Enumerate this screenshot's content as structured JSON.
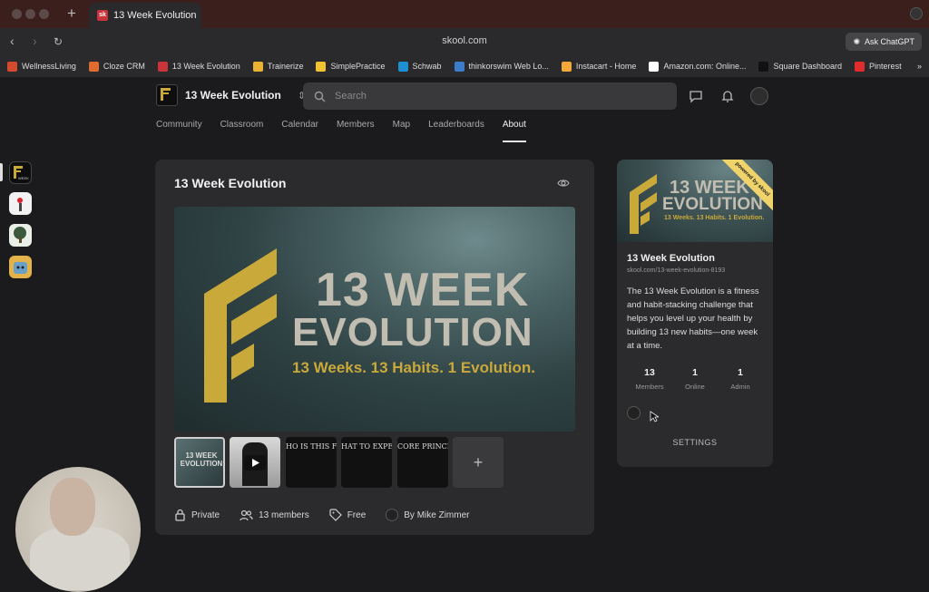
{
  "browser": {
    "tab_title": "13 Week Evolution",
    "url": "skool.com",
    "ask_chatgpt": "Ask ChatGPT",
    "bookmarks": [
      {
        "label": "WellnessLiving",
        "color": "#d44a2e"
      },
      {
        "label": "Cloze CRM",
        "color": "#e06b2f"
      },
      {
        "label": "13 Week Evolution",
        "color": "#c8343a"
      },
      {
        "label": "Trainerize",
        "color": "#e9b233"
      },
      {
        "label": "SimplePractice",
        "color": "#f1c232"
      },
      {
        "label": "Schwab",
        "color": "#1d8fd1"
      },
      {
        "label": "thinkorswim Web Lo...",
        "color": "#3d7cc9"
      },
      {
        "label": "Instacart - Home",
        "color": "#f2a83a"
      },
      {
        "label": "Amazon.com: Online...",
        "color": "#ffffff"
      },
      {
        "label": "Square Dashboard",
        "color": "#111111"
      },
      {
        "label": "Pinterest",
        "color": "#e02c2c"
      }
    ]
  },
  "header": {
    "group_name": "13 Week Evolution",
    "search_placeholder": "Search",
    "tabs": [
      "Community",
      "Classroom",
      "Calendar",
      "Members",
      "Map",
      "Leaderboards",
      "About"
    ],
    "active_tab": "About"
  },
  "main": {
    "title": "13 Week Evolution",
    "hero": {
      "line1": "13 WEEK",
      "line2": "EVOLUTION",
      "tagline": "13 Weeks. 13 Habits. 1 Evolution."
    },
    "thumbnails": [
      {
        "text": "13 WEEK EVOLUTION"
      },
      {
        "text": ""
      },
      {
        "text": "HO IS THIS FO"
      },
      {
        "text": "HAT TO EXPE"
      },
      {
        "text": "CORE PRINCI"
      }
    ],
    "add_label": "+",
    "meta": {
      "privacy": "Private",
      "members": "13 members",
      "price": "Free",
      "owner": "By Mike Zimmer"
    }
  },
  "sidebar": {
    "ribbon": "powered by skool",
    "hero_line1": "13 WEEK",
    "hero_line2": "EVOLUTION",
    "hero_tagline": "13 Weeks. 13 Habits. 1 Evolution.",
    "name": "13 Week Evolution",
    "url": "skool.com/13-week-evolution-8193",
    "description": "The 13 Week Evolution is a fitness and habit-stacking challenge that helps you level up your health by building 13 new habits—one week at a time.",
    "stats": [
      {
        "value": "13",
        "label": "Members"
      },
      {
        "value": "1",
        "label": "Online"
      },
      {
        "value": "1",
        "label": "Admin"
      }
    ],
    "settings_label": "SETTINGS"
  },
  "colors": {
    "brand_gold": "#c9a93a",
    "background": "#1b1b1d",
    "card": "#2b2b2d"
  }
}
